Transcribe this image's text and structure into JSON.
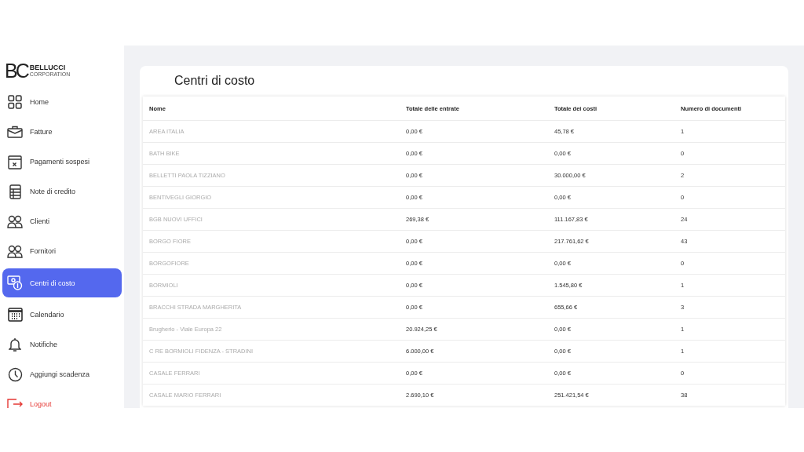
{
  "brand": {
    "mark": "BC",
    "name": "BELLUCCI",
    "tagline": "CORPORATION"
  },
  "sidebar": {
    "items": [
      {
        "label": "Home",
        "selected": false,
        "kind": "nav"
      },
      {
        "label": "Fatture",
        "selected": false,
        "kind": "nav"
      },
      {
        "label": "Pagamenti sospesi",
        "selected": false,
        "kind": "nav"
      },
      {
        "label": "Note di credito",
        "selected": false,
        "kind": "nav"
      },
      {
        "label": "Clienti",
        "selected": false,
        "kind": "nav"
      },
      {
        "label": "Fornitori",
        "selected": false,
        "kind": "nav"
      },
      {
        "label": "Centri di costo",
        "selected": true,
        "kind": "nav"
      },
      {
        "label": "Calendario",
        "selected": false,
        "kind": "nav"
      },
      {
        "label": "Notifiche",
        "selected": false,
        "kind": "nav"
      },
      {
        "label": "Aggiungi scadenza",
        "selected": false,
        "kind": "nav"
      },
      {
        "label": "Logout",
        "selected": false,
        "kind": "logout"
      }
    ]
  },
  "page": {
    "title": "Centri di costo"
  },
  "table": {
    "columns": [
      "Nome",
      "Totale delle entrate",
      "Totale dei costi",
      "Numero di documenti"
    ],
    "rows": [
      [
        "AREA ITALIA",
        "0,00 €",
        "45,78 €",
        "1"
      ],
      [
        "BATH BIKE",
        "0,00 €",
        "0,00 €",
        "0"
      ],
      [
        "BELLETTI PAOLA TIZZIANO",
        "0,00 €",
        "30.000,00 €",
        "2"
      ],
      [
        "BENTIVEGLI GIORGIO",
        "0,00 €",
        "0,00 €",
        "0"
      ],
      [
        "BGB NUOVI UFFICI",
        "269,38 €",
        "111.167,83 €",
        "24"
      ],
      [
        "BORGO FIORE",
        "0,00 €",
        "217.761,62 €",
        "43"
      ],
      [
        "BORGOFIORE",
        "0,00 €",
        "0,00 €",
        "0"
      ],
      [
        "BORMIOLI",
        "0,00 €",
        "1.545,80 €",
        "1"
      ],
      [
        "BRACCHI STRADA MARGHERITA",
        "0,00 €",
        "655,66 €",
        "3"
      ],
      [
        "Brugherio - Viale Europa 22",
        "20.924,25 €",
        "0,00 €",
        "1"
      ],
      [
        "C RE BORMIOLI FIDENZA - STRADINI",
        "6.000,00 €",
        "0,00 €",
        "1"
      ],
      [
        "CASALE FERRARI",
        "0,00 €",
        "0,00 €",
        "0"
      ],
      [
        "CASALE MARIO FERRARI",
        "2.690,10 €",
        "251.421,54 €",
        "38"
      ]
    ]
  }
}
